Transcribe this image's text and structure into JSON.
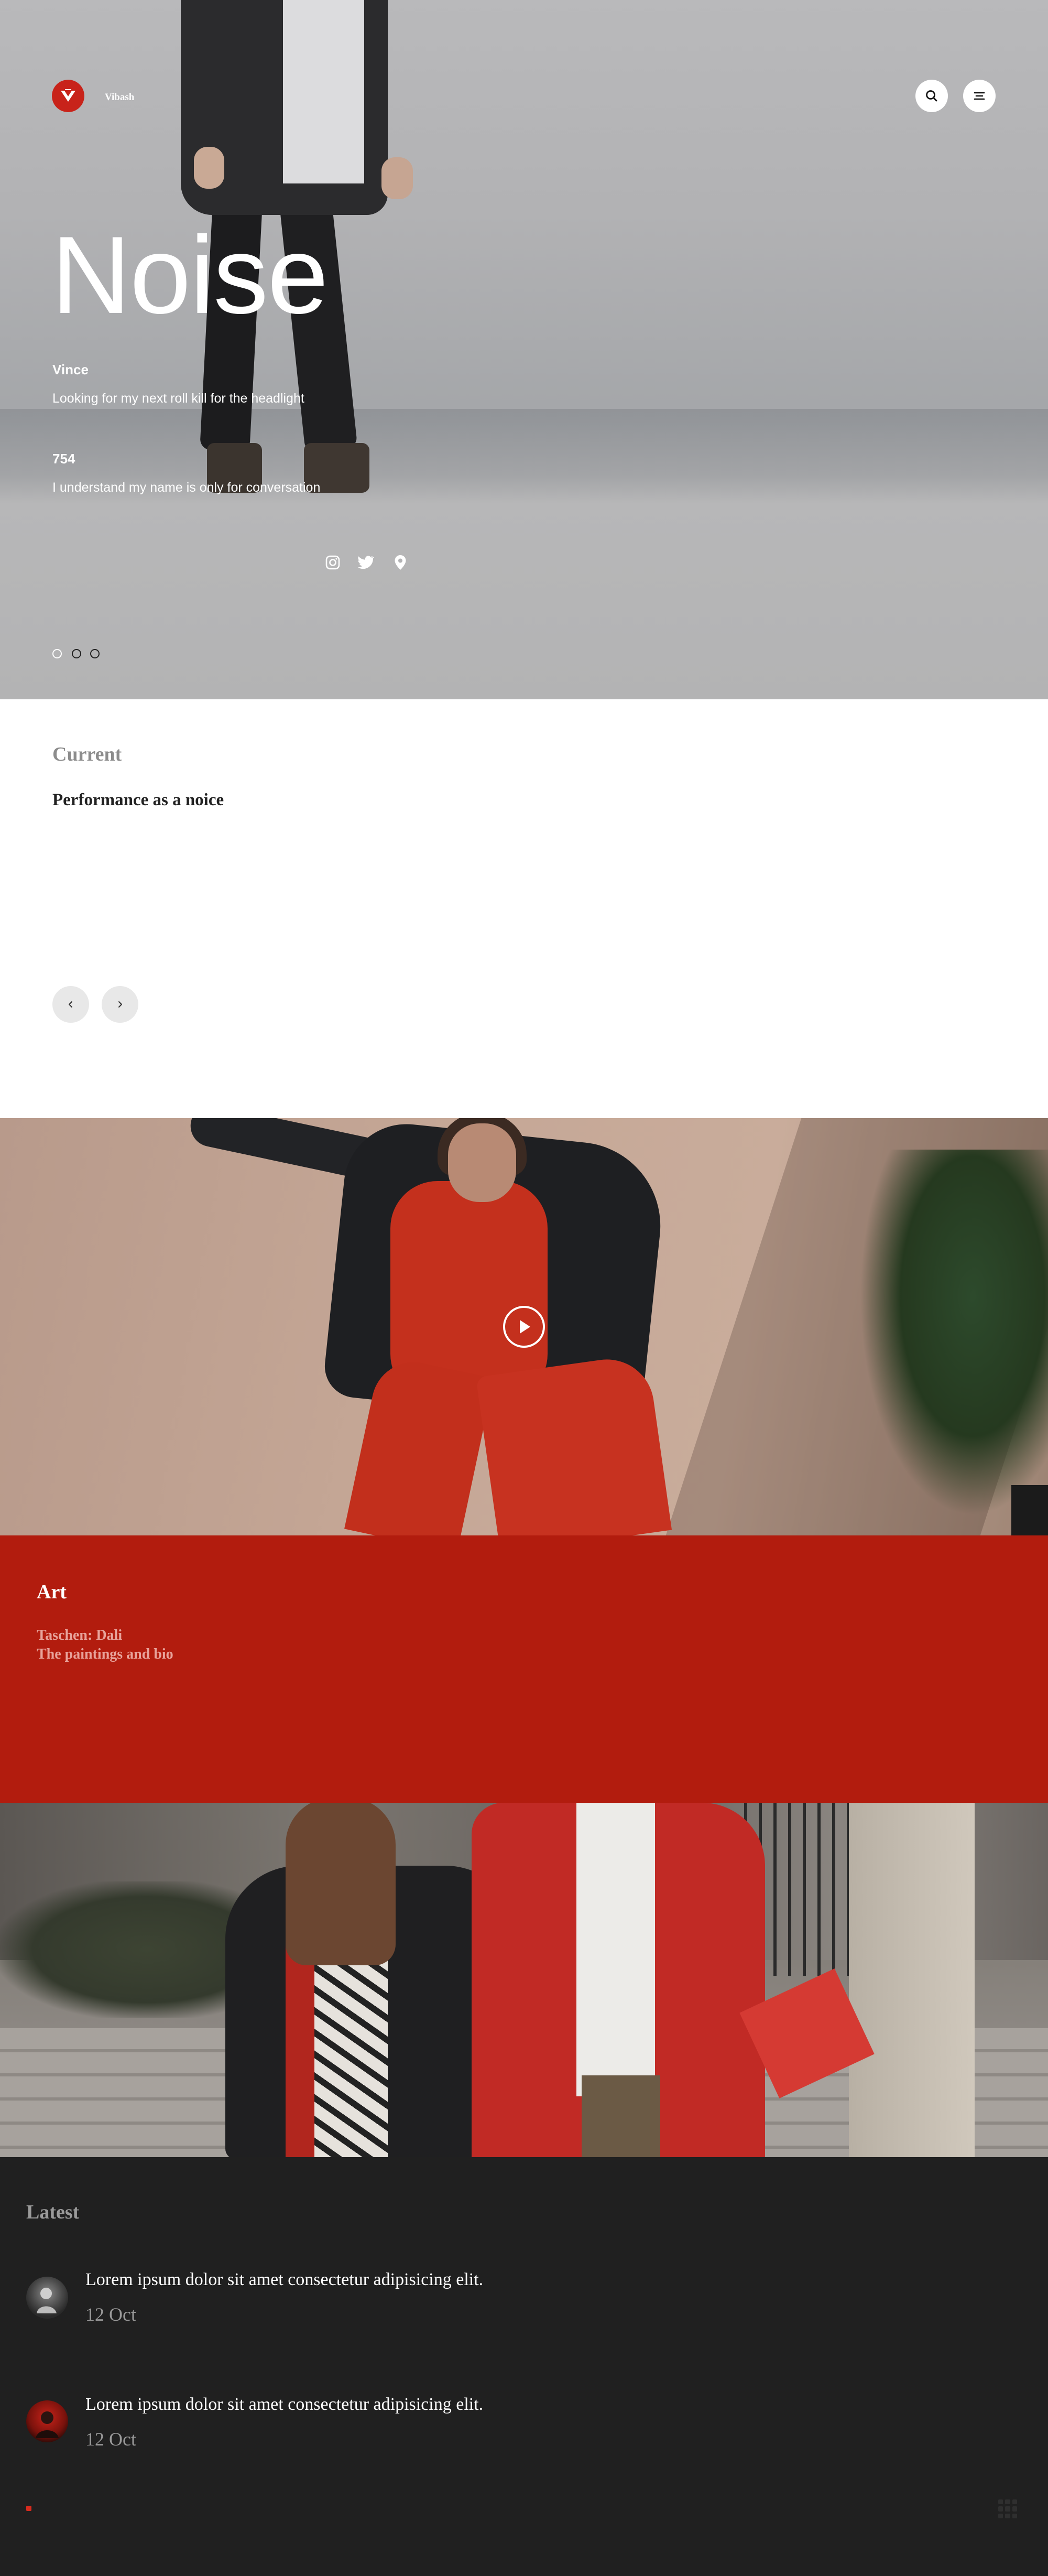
{
  "header": {
    "logo_text": "Vibash",
    "search_icon": "search-icon",
    "menu_icon": "menu-icon"
  },
  "hero": {
    "title": "Noise",
    "name": "Vince",
    "subtitle": "Looking for my next roll kill for the headlight",
    "count": "754",
    "subtitle2": "I understand my name is only for conversation",
    "social_icons": [
      "instagram-icon",
      "twitter-icon",
      "location-pin-icon"
    ],
    "slider_dots": 3,
    "active_dot": 1
  },
  "current": {
    "label": "Current",
    "title": "Performance as a noice",
    "prev_icon": "chevron-left-icon",
    "next_icon": "chevron-right-icon"
  },
  "video": {
    "play_icon": "play-icon"
  },
  "art": {
    "label": "Art",
    "line1": "Taschen: Dali",
    "line2": "The paintings and bio"
  },
  "latest": {
    "label": "Latest",
    "posts": [
      {
        "text": "Lorem ipsum dolor sit amet consectetur adipisicing elit.",
        "date": "12 Oct"
      },
      {
        "text": "Lorem ipsum dolor sit amet consectetur adipisicing elit.",
        "date": "12 Oct"
      }
    ]
  },
  "colors": {
    "brand_red": "#c8231a",
    "art_background": "#b21c0e",
    "latest_background": "#202020"
  }
}
